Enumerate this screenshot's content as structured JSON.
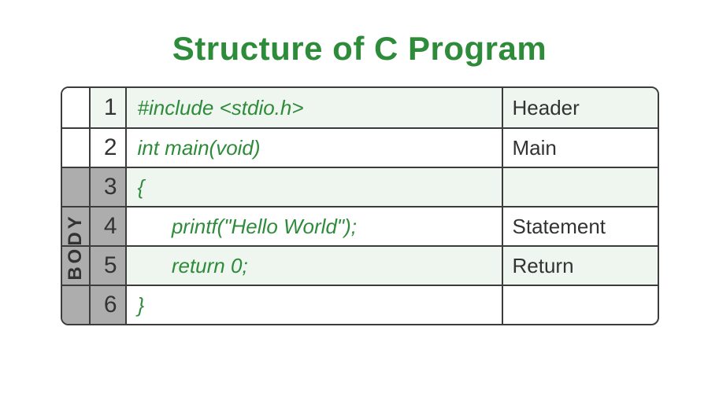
{
  "title": "Structure of C Program",
  "body_label": "BODY",
  "rows": [
    {
      "num": "1",
      "code": "#include <stdio.h>",
      "label": "Header",
      "stripe": true,
      "in_body": false
    },
    {
      "num": "2",
      "code": "int main(void)",
      "label": "Main",
      "stripe": false,
      "in_body": false
    },
    {
      "num": "3",
      "code": "{",
      "label": "",
      "stripe": true,
      "in_body": true
    },
    {
      "num": "4",
      "code": "      printf(\"Hello World\");",
      "label": "Statement",
      "stripe": false,
      "in_body": true
    },
    {
      "num": "5",
      "code": "      return 0;",
      "label": "Return",
      "stripe": true,
      "in_body": true
    },
    {
      "num": "6",
      "code": "}",
      "label": "",
      "stripe": false,
      "in_body": true
    }
  ]
}
